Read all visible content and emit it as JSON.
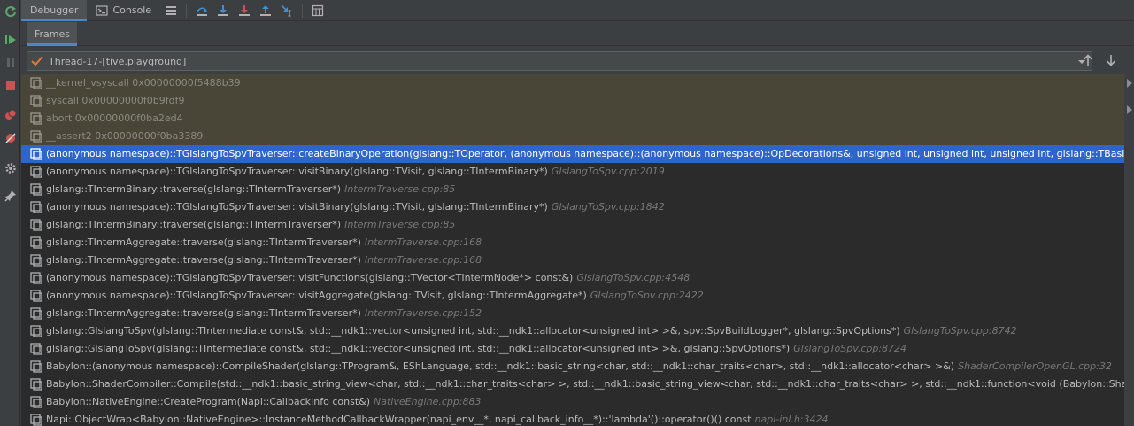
{
  "tabs": {
    "debugger": "Debugger",
    "console": "Console"
  },
  "subtabs": {
    "frames": "Frames"
  },
  "thread": {
    "selected": "Thread-17-[tive.playground]"
  },
  "frames": [
    {
      "text": "__kernel_vsyscall 0x00000000f5488b39",
      "loc": "",
      "kind": "lib"
    },
    {
      "text": "syscall 0x00000000f0b9fdf9",
      "loc": "",
      "kind": "lib"
    },
    {
      "text": "abort 0x00000000f0ba2ed4",
      "loc": "",
      "kind": "lib"
    },
    {
      "text": "__assert2 0x00000000f0ba3389",
      "loc": "",
      "kind": "lib"
    },
    {
      "text": "(anonymous namespace)::TGlslangToSpvTraverser::createBinaryOperation(glslang::TOperator, (anonymous namespace)::(anonymous namespace)::OpDecorations&, unsigned int, unsigned int, unsigned int, glslang::TBasicType, bool)",
      "loc": "",
      "kind": "selected"
    },
    {
      "text": "(anonymous namespace)::TGlslangToSpvTraverser::visitBinary(glslang::TVisit, glslang::TIntermBinary*)",
      "loc": "GlslangToSpv.cpp:2019",
      "kind": "normal"
    },
    {
      "text": "glslang::TIntermBinary::traverse(glslang::TIntermTraverser*)",
      "loc": "IntermTraverse.cpp:85",
      "kind": "normal"
    },
    {
      "text": "(anonymous namespace)::TGlslangToSpvTraverser::visitBinary(glslang::TVisit, glslang::TIntermBinary*)",
      "loc": "GlslangToSpv.cpp:1842",
      "kind": "normal"
    },
    {
      "text": "glslang::TIntermBinary::traverse(glslang::TIntermTraverser*)",
      "loc": "IntermTraverse.cpp:85",
      "kind": "normal"
    },
    {
      "text": "glslang::TIntermAggregate::traverse(glslang::TIntermTraverser*)",
      "loc": "IntermTraverse.cpp:168",
      "kind": "normal"
    },
    {
      "text": "glslang::TIntermAggregate::traverse(glslang::TIntermTraverser*)",
      "loc": "IntermTraverse.cpp:168",
      "kind": "normal"
    },
    {
      "text": "(anonymous namespace)::TGlslangToSpvTraverser::visitFunctions(glslang::TVector<TIntermNode*> const&)",
      "loc": "GlslangToSpv.cpp:4548",
      "kind": "normal"
    },
    {
      "text": "(anonymous namespace)::TGlslangToSpvTraverser::visitAggregate(glslang::TVisit, glslang::TIntermAggregate*)",
      "loc": "GlslangToSpv.cpp:2422",
      "kind": "normal"
    },
    {
      "text": "glslang::TIntermAggregate::traverse(glslang::TIntermTraverser*)",
      "loc": "IntermTraverse.cpp:152",
      "kind": "normal"
    },
    {
      "text": "glslang::GlslangToSpv(glslang::TIntermediate const&, std::__ndk1::vector<unsigned int, std::__ndk1::allocator<unsigned int> >&, spv::SpvBuildLogger*, glslang::SpvOptions*)",
      "loc": "GlslangToSpv.cpp:8742",
      "kind": "normal"
    },
    {
      "text": "glslang::GlslangToSpv(glslang::TIntermediate const&, std::__ndk1::vector<unsigned int, std::__ndk1::allocator<unsigned int> >&, glslang::SpvOptions*)",
      "loc": "GlslangToSpv.cpp:8724",
      "kind": "normal"
    },
    {
      "text": "Babylon::(anonymous namespace)::CompileShader(glslang::TProgram&, EShLanguage, std::__ndk1::basic_string<char, std::__ndk1::char_traits<char>, std::__ndk1::allocator<char> >&)",
      "loc": "ShaderCompilerOpenGL.cpp:32",
      "kind": "normal"
    },
    {
      "text": "Babylon::ShaderCompiler::Compile(std::__ndk1::basic_string_view<char, std::__ndk1::char_traits<char> >, std::__ndk1::basic_string_view<char, std::__ndk1::char_traits<char> >, std::__ndk1::function<void (Babylon::ShaderCompiler::Sh",
      "loc": "",
      "kind": "normal"
    },
    {
      "text": "Babylon::NativeEngine::CreateProgram(Napi::CallbackInfo const&)",
      "loc": "NativeEngine.cpp:883",
      "kind": "normal"
    },
    {
      "text": "Napi::ObjectWrap<Babylon::NativeEngine>::InstanceMethodCallbackWrapper(napi_env__*, napi_callback_info__*)::'lambda'()::operator()() const",
      "loc": "napi-inl.h:3424",
      "kind": "normal"
    }
  ],
  "colors": {
    "accent": "#4a88c7",
    "selection": "#2f65ca",
    "library_frame_bg": "#4a4637",
    "list_bg": "#2b2b2b"
  }
}
